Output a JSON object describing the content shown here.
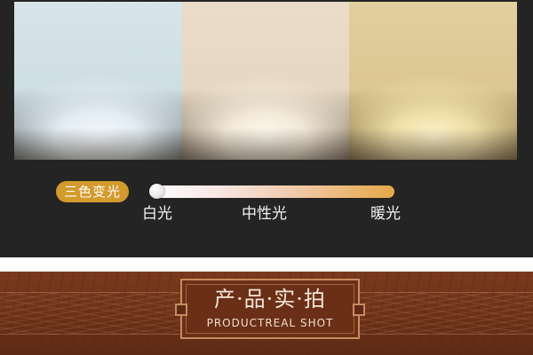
{
  "color_temp": {
    "badge_label": "三色变光",
    "slider_position": 0,
    "labels": {
      "white": "白光",
      "neutral": "中性光",
      "warm": "暖光"
    }
  },
  "banner": {
    "title": "产·品·实·拍",
    "subtitle": "PRODUCTREAL SHOT"
  },
  "colors": {
    "badge": "#d39a2c",
    "banner": "#6a2f16",
    "background": "#242424"
  }
}
